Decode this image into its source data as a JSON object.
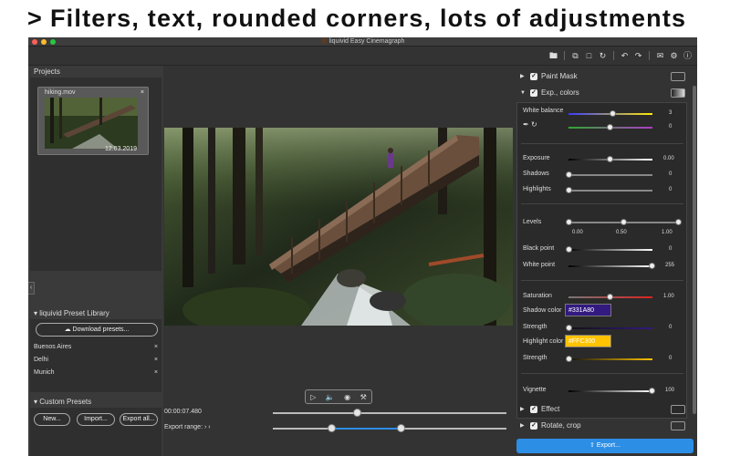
{
  "headline": {
    "text": "Filters, text, rounded corners, lots of adjustments"
  },
  "window": {
    "title": "liquivid Easy Cinemagraph"
  },
  "projects": {
    "header": "Projects",
    "item": {
      "name": "hiking.mov",
      "date": "12.03.2019"
    }
  },
  "preset_library": {
    "header": "liquivid Preset Library",
    "download_label": "Download presets...",
    "items": [
      {
        "label": "Buenos Aires"
      },
      {
        "label": "Delhi"
      },
      {
        "label": "Munich"
      }
    ]
  },
  "custom_presets": {
    "header": "Custom Presets",
    "new_label": "New...",
    "import_label": "Import...",
    "export_all_label": "Export all..."
  },
  "playback": {
    "timecode": "00:00:07.480",
    "export_range_label": "Export range:",
    "position": 0.36,
    "range_start": 0.25,
    "range_end": 0.55
  },
  "adjust": {
    "paint_mask": "Paint Mask",
    "exp_colors": "Exp., colors",
    "white_balance": {
      "label": "White balance",
      "value1": "3",
      "value2": "0"
    },
    "exposure": {
      "label": "Exposure",
      "value": "0.00"
    },
    "shadows": {
      "label": "Shadows",
      "value": "0"
    },
    "highlights": {
      "label": "Highlights",
      "value": "0"
    },
    "levels": {
      "label": "Levels",
      "v0": "0.00",
      "v1": "0.50",
      "v2": "1.00"
    },
    "black_point": {
      "label": "Black point",
      "value": "0"
    },
    "white_point": {
      "label": "White point",
      "value": "255"
    },
    "saturation": {
      "label": "Saturation",
      "value": "1.00"
    },
    "shadow_color": {
      "label": "Shadow color",
      "hex": "#331A80"
    },
    "strength1": {
      "label": "Strength",
      "value": "0"
    },
    "highlight_color": {
      "label": "Highlight color",
      "hex": "#FFC300"
    },
    "strength2": {
      "label": "Strength",
      "value": "0"
    },
    "vignette": {
      "label": "Vignette",
      "value": "100"
    },
    "effect": "Effect",
    "rotate_crop": "Rotate, crop",
    "export_label": "Export..."
  },
  "colors": {
    "accent": "#2d8ee5",
    "shadow": "#331A80",
    "highlight": "#FFC300"
  }
}
